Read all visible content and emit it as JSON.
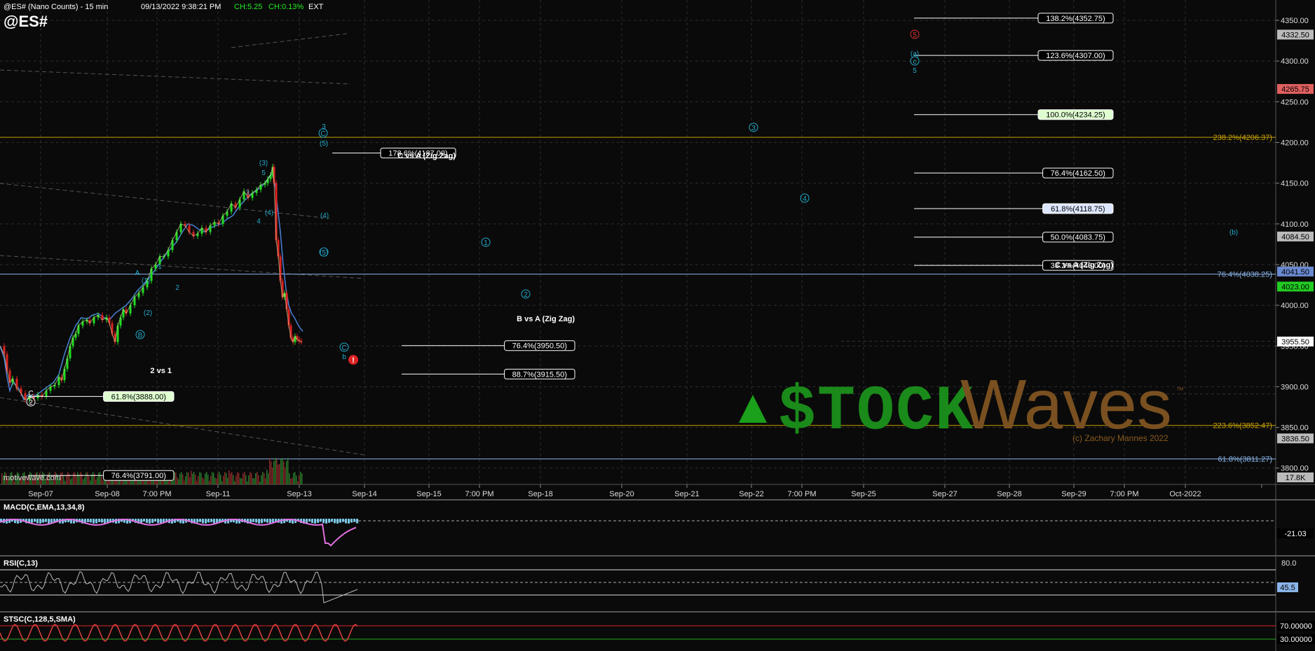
{
  "header": {
    "symbol_line": "@ES# (Nano Counts) - 15 min",
    "datetime": "09/13/2022 9:38:21 PM",
    "change_points": "CH:5.25",
    "change_pct": "CH:0.13%",
    "session": "EXT",
    "big_symbol": "@ES#"
  },
  "colors": {
    "background": "#0a0a0a",
    "grid": "#2c2c2c",
    "up_candle": "#22dd22",
    "down_candle": "#dd2222",
    "fib_box": "#ffffff",
    "cyan_label": "#22aacc",
    "gold_line": "#c8a000",
    "blue_line": "#8ab4e8",
    "macd_line": "#e070e0",
    "macd_hist": "#79c6e6",
    "rsi_line": "#bbbbbb",
    "stoch_line": "#e04040",
    "watermark_green": "#1aa01a",
    "watermark_brown": "#8a5a1e"
  },
  "watermark": {
    "stock": "$TOCK",
    "waves": "Waves",
    "tm": "™",
    "copyright": "(c) Zachary Mannes 2022",
    "site": "motivewave.com"
  },
  "chart_data": {
    "type": "line",
    "title": "@ES# (Nano Counts) - 15 min",
    "xlabel": "",
    "ylabel": "",
    "ylim": [
      3780,
      4375
    ],
    "grid": true,
    "y_ticks": [
      3800,
      3850,
      3900,
      3950,
      4000,
      4050,
      4100,
      4150,
      4200,
      4250,
      4300,
      4350
    ],
    "y_tick_labels": [
      "3800.00",
      "3850.00",
      "3900.00",
      "3950.00",
      "4000.00",
      "4050.00",
      "4100.00",
      "4150.00",
      "4200.00",
      "4250.00",
      "4300.00",
      "4350.00"
    ],
    "x_labels": [
      "Sep-07",
      "Sep-08",
      "7:00 PM",
      "Sep-11",
      "Sep-13",
      "Sep-14",
      "Sep-15",
      "7:00 PM",
      "Sep-18",
      "Sep-20",
      "Sep-21",
      "Sep-22",
      "7:00 PM",
      "Sep-25",
      "Sep-27",
      "Sep-28",
      "Sep-29",
      "7:00 PM",
      "Oct-2022"
    ],
    "series": [
      {
        "values": [
          [
            0,
            3950
          ],
          [
            6,
            3935
          ],
          [
            10,
            3912
          ],
          [
            14,
            3895
          ],
          [
            18,
            3905
          ],
          [
            23,
            3902
          ],
          [
            28,
            3896
          ],
          [
            34,
            3884
          ],
          [
            40,
            3890
          ],
          [
            46,
            3888
          ],
          [
            52,
            3890
          ],
          [
            60,
            3895
          ],
          [
            68,
            3900
          ],
          [
            76,
            3905
          ],
          [
            84,
            3915
          ],
          [
            92,
            3940
          ],
          [
            100,
            3960
          ],
          [
            108,
            3975
          ],
          [
            116,
            3985
          ],
          [
            124,
            3983
          ],
          [
            132,
            3988
          ],
          [
            140,
            3990
          ],
          [
            148,
            3985
          ],
          [
            156,
            3982
          ],
          [
            164,
            3990
          ],
          [
            172,
            3995
          ],
          [
            180,
            4000
          ],
          [
            188,
            4008
          ],
          [
            196,
            4018
          ],
          [
            204,
            4025
          ],
          [
            212,
            4033
          ],
          [
            220,
            4042
          ],
          [
            228,
            4052
          ],
          [
            236,
            4062
          ],
          [
            244,
            4070
          ],
          [
            252,
            4078
          ],
          [
            260,
            4090
          ],
          [
            268,
            4100
          ],
          [
            276,
            4098
          ],
          [
            284,
            4093
          ],
          [
            292,
            4090
          ],
          [
            300,
            4095
          ],
          [
            308,
            4098
          ],
          [
            316,
            4100
          ],
          [
            324,
            4106
          ],
          [
            332,
            4110
          ],
          [
            340,
            4120
          ],
          [
            348,
            4128
          ],
          [
            356,
            4135
          ],
          [
            364,
            4140
          ],
          [
            372,
            4145
          ],
          [
            378,
            4150
          ],
          [
            384,
            4158
          ],
          [
            388,
            4162
          ],
          [
            392,
            4150
          ],
          [
            396,
            4120
          ],
          [
            400,
            4090
          ],
          [
            404,
            4050
          ],
          [
            408,
            4020
          ],
          [
            412,
            4000
          ],
          [
            416,
            3990
          ],
          [
            420,
            3985
          ],
          [
            424,
            3978
          ],
          [
            428,
            3972
          ],
          [
            432,
            3968
          ]
        ]
      },
      {
        "values": [
          [
            0,
            3950
          ],
          [
            6,
            3940
          ],
          [
            10,
            3920
          ],
          [
            14,
            3905
          ],
          [
            18,
            3910
          ],
          [
            24,
            3898
          ],
          [
            30,
            3892
          ],
          [
            36,
            3884
          ],
          [
            42,
            3888
          ],
          [
            48,
            3886
          ],
          [
            54,
            3890
          ],
          [
            60,
            3888
          ],
          [
            66,
            3895
          ],
          [
            72,
            3900
          ],
          [
            78,
            3902
          ],
          [
            84,
            3912
          ],
          [
            88,
            3908
          ],
          [
            92,
            3922
          ],
          [
            96,
            3935
          ],
          [
            100,
            3950
          ],
          [
            104,
            3960
          ],
          [
            108,
            3965
          ],
          [
            112,
            3975
          ],
          [
            118,
            3980
          ],
          [
            124,
            3982
          ],
          [
            128,
            3978
          ],
          [
            134,
            3985
          ],
          [
            140,
            3988
          ],
          [
            146,
            3982
          ],
          [
            152,
            3985
          ],
          [
            156,
            3978
          ],
          [
            160,
            3965
          ],
          [
            164,
            3955
          ],
          [
            168,
            3975
          ],
          [
            172,
            3985
          ],
          [
            176,
            3995
          ],
          [
            180,
            3990
          ],
          [
            186,
            4000
          ],
          [
            192,
            4010
          ],
          [
            198,
            4015
          ],
          [
            204,
            4022
          ],
          [
            210,
            4030
          ],
          [
            216,
            4045
          ],
          [
            222,
            4050
          ],
          [
            228,
            4060
          ],
          [
            234,
            4060
          ],
          [
            240,
            4068
          ],
          [
            246,
            4080
          ],
          [
            252,
            4090
          ],
          [
            258,
            4100
          ],
          [
            264,
            4098
          ],
          [
            270,
            4090
          ],
          [
            276,
            4085
          ],
          [
            282,
            4088
          ],
          [
            288,
            4095
          ],
          [
            294,
            4090
          ],
          [
            300,
            4098
          ],
          [
            306,
            4102
          ],
          [
            312,
            4100
          ],
          [
            318,
            4110
          ],
          [
            324,
            4115
          ],
          [
            330,
            4125
          ],
          [
            336,
            4120
          ],
          [
            342,
            4130
          ],
          [
            348,
            4140
          ],
          [
            354,
            4132
          ],
          [
            360,
            4138
          ],
          [
            366,
            4142
          ],
          [
            372,
            4148
          ],
          [
            378,
            4150
          ],
          [
            382,
            4155
          ],
          [
            386,
            4160
          ],
          [
            389,
            4170
          ],
          [
            391,
            4150
          ],
          [
            394,
            4080
          ],
          [
            397,
            4060
          ],
          [
            400,
            4030
          ],
          [
            403,
            4010
          ],
          [
            406,
            4015
          ],
          [
            409,
            3995
          ],
          [
            412,
            3975
          ],
          [
            415,
            3960
          ],
          [
            418,
            3955
          ],
          [
            421,
            3962
          ],
          [
            424,
            3958
          ],
          [
            427,
            3956
          ],
          [
            430,
            3955
          ]
        ]
      }
    ],
    "overlay_lines": [
      {
        "label": "238.2%(4206.37)",
        "value": 4206.37,
        "color": "#c8a000"
      },
      {
        "label": "76.4%(4038.25)",
        "value": 4038.25,
        "color": "#8ab4e8"
      },
      {
        "label": "223.6%(3852.47)",
        "value": 3852.47,
        "color": "#c8a000"
      },
      {
        "label": "61.8%(3811.27)",
        "value": 3811.27,
        "color": "#8ab4e8"
      }
    ],
    "price_badges": [
      {
        "label": "4332.50",
        "value": 4332.5,
        "bg": "#bbbbbb",
        "fg": "#000000"
      },
      {
        "label": "4265.75",
        "value": 4265.75,
        "bg": "#e06060",
        "fg": "#000000"
      },
      {
        "label": "4084.50",
        "value": 4084.5,
        "bg": "#bbbbbb",
        "fg": "#000000"
      },
      {
        "label": "4041.50",
        "value": 4041.5,
        "bg": "#6a8ad0",
        "fg": "#000000"
      },
      {
        "label": "4023.00",
        "value": 4023,
        "bg": "#22cc22",
        "fg": "#000000"
      },
      {
        "label": "3955.50",
        "value": 3955.5,
        "bg": "#ffffff",
        "fg": "#000000"
      },
      {
        "label": "3836.50",
        "value": 3836.5,
        "bg": "#bbbbbb",
        "fg": "#000000"
      }
    ],
    "volume_badge": "17.8K",
    "fib_levels": [
      {
        "label": "138.2%(4352.75)",
        "value": 4352.75,
        "group": "right",
        "bg": "#000000",
        "fg": "#ffffff"
      },
      {
        "label": "123.6%(4307.00)",
        "value": 4307,
        "group": "right",
        "bg": "#000000",
        "fg": "#ffffff"
      },
      {
        "label": "100.0%(4234.25)",
        "value": 4234.25,
        "group": "right",
        "bg": "#dfffd0",
        "fg": "#000000"
      },
      {
        "label": "76.4%(4162.50)",
        "value": 4162.5,
        "group": "right",
        "bg": "#000000",
        "fg": "#ffffff"
      },
      {
        "label": "61.8%(4118.75)",
        "value": 4118.75,
        "group": "right",
        "bg": "#dde6ff",
        "fg": "#000000"
      },
      {
        "label": "50.0%(4083.75)",
        "value": 4083.75,
        "group": "right",
        "bg": "#000000",
        "fg": "#ffffff"
      },
      {
        "label": "38.2%(4049.00)",
        "value": 4049,
        "group": "right",
        "bg": "#000000",
        "fg": "#ffffff"
      },
      {
        "label": "178.6%(4187.00)",
        "value": 4187,
        "group": "top",
        "bg": "#000000",
        "fg": "#ffffff"
      },
      {
        "label": "76.4%(3950.50)",
        "value": 3950.5,
        "group": "middle",
        "bg": "#000000",
        "fg": "#ffffff"
      },
      {
        "label": "88.7%(3915.50)",
        "value": 3915.5,
        "group": "middle",
        "bg": "#000000",
        "fg": "#ffffff"
      },
      {
        "label": "61.8%(3888.00)",
        "value": 3888,
        "group": "left",
        "bg": "#dfffd0",
        "fg": "#000000"
      },
      {
        "label": "76.4%(3791.00)",
        "value": 3791,
        "group": "left",
        "bg": "#000000",
        "fg": "#ffffff"
      }
    ],
    "fib_titles": [
      {
        "label": "C vs A (Zig Zag)",
        "group": "top"
      },
      {
        "label": "C vs A (Zig Zag)",
        "group": "right"
      },
      {
        "label": "B vs A (Zig Zag)",
        "group": "middle"
      },
      {
        "label": "2 vs 1",
        "group": "left"
      }
    ],
    "wave_labels": [
      "2",
      "C",
      "A",
      "B",
      "(1)",
      "(2)",
      "1",
      "2",
      "3",
      "4",
      "(3)",
      "(4)",
      "5",
      "(5)",
      "3",
      "C",
      "(4)",
      "(5)",
      "C",
      "b",
      "!",
      "1",
      "2",
      "3",
      "4",
      "5",
      "(a)",
      "c",
      "5",
      "(b)",
      "(b)"
    ],
    "indicators": [
      {
        "name": "MACD(C,EMA,13,34,8)",
        "value_label": "-21.03"
      },
      {
        "name": "RSI(C,13)",
        "value_label": "45.5",
        "level_label": "80.0"
      },
      {
        "name": "STSC(C,128,5,SMA)",
        "value_labels": [
          "70.00000",
          "30.00000"
        ]
      }
    ]
  }
}
